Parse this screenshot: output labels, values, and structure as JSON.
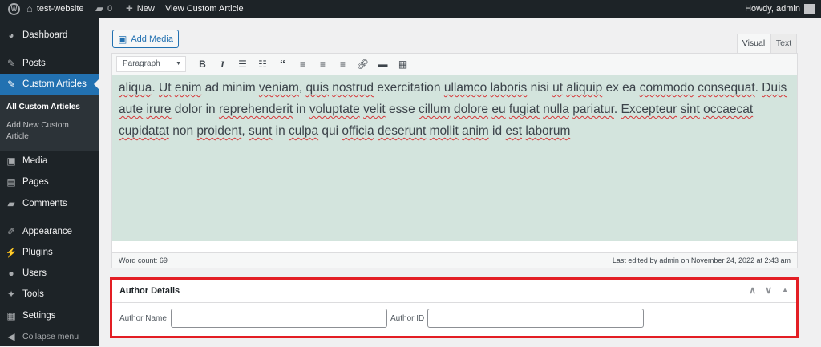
{
  "adminbar": {
    "site": "test-website",
    "comments": "0",
    "new": "New",
    "view": "View Custom Article",
    "howdy": "Howdy, admin"
  },
  "sidebar": {
    "items": [
      "Dashboard",
      "Posts",
      "Custom Articles",
      "Media",
      "Pages",
      "Comments",
      "Appearance",
      "Plugins",
      "Users",
      "Tools",
      "Settings",
      "Collapse menu"
    ],
    "submenu": [
      "All Custom Articles",
      "Add New Custom",
      "Article"
    ]
  },
  "editor": {
    "add_media": "Add Media",
    "tabs": [
      "Visual",
      "Text"
    ],
    "format": "Paragraph",
    "lines": [
      [
        "aliqua",
        ". ",
        "Ut",
        " ",
        "enim",
        " ad minim ",
        "veniam",
        ", ",
        "quis",
        " ",
        "nostrud",
        " exercitation ",
        "ullamco",
        " ",
        "laboris",
        " nisi ",
        "ut",
        " ",
        "aliquip",
        " ex ea ",
        "commodo",
        " ",
        "consequat",
        ". ",
        "Duis"
      ],
      [
        "aute",
        " ",
        "irure",
        " dolor in ",
        "reprehenderit",
        " in ",
        "voluptate",
        " ",
        "velit",
        " esse ",
        "cillum",
        " ",
        "dolore",
        " ",
        "eu",
        " ",
        "fugiat",
        " ",
        "nulla",
        " ",
        "pariatur",
        ". ",
        "Excepteur",
        " ",
        "sint",
        " ",
        "occaecat"
      ],
      [
        "cupidatat",
        " non ",
        "proident",
        ", ",
        "sunt",
        " in ",
        "culpa",
        " qui ",
        "officia",
        " ",
        "deserunt",
        " ",
        "mollit",
        " ",
        "anim",
        " id ",
        "est",
        " ",
        "laborum",
        ""
      ]
    ],
    "word_count": "Word count: 69",
    "last_edited": "Last edited by admin on November 24, 2022 at 2:43 am"
  },
  "author": {
    "title": "Author Details",
    "name_label": "Author Name",
    "name_value": "",
    "id_label": "Author ID",
    "id_value": ""
  }
}
